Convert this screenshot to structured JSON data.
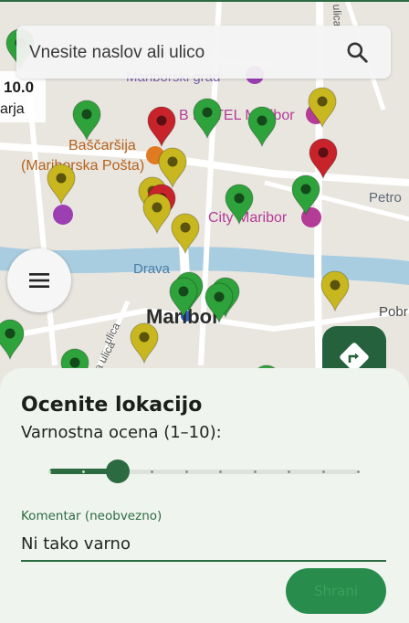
{
  "search": {
    "placeholder": "Vnesite naslov ali ulico",
    "icon": "search-icon"
  },
  "map": {
    "scale_value": "10.0",
    "scale_unit": "arja",
    "labels": {
      "mariborski_grad": "Mariborski grad",
      "bascarsija": "Baščaršija",
      "mariborska_posta": "(Mariborska Pošta)",
      "hotel": "B HOTEL Maribor",
      "city": "City Maribor",
      "drava": "Drava",
      "maribor": "Maribor",
      "petrol": "Petro",
      "pobr": "Pobr",
      "ulica": "ulica",
      "tega_ulica": "rtega ulica",
      "ulica_right": "ulica"
    }
  },
  "menu": {
    "icon": "menu-icon"
  },
  "navigation": {
    "icon": "directions-icon"
  },
  "rating": {
    "title": "Ocenite lokacijo",
    "slider_label": "Varnostna ocena (1–10):",
    "slider_min": 1,
    "slider_max": 10,
    "slider_value": 3,
    "comment_label": "Komentar (neobvezno)",
    "comment_value": "Ni tako varno",
    "save_label": "Shrani"
  },
  "colors": {
    "primary": "#2c6b41",
    "pin_green": "#2ea23b",
    "pin_yellow": "#c8b71f",
    "pin_red": "#c8232b",
    "sheet_bg": "#eff4ee"
  }
}
